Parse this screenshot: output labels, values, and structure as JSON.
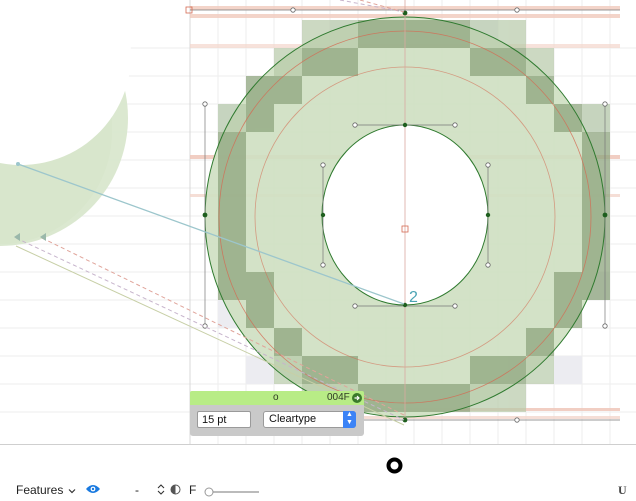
{
  "glyph_panel": {
    "glyph_name": "o",
    "unicode": "004F",
    "go_icon": "arrow-right-circle-icon",
    "size_value": "15 pt",
    "rendering_mode": "Cleartype"
  },
  "canvas": {
    "point_label": "2",
    "colors": {
      "glyph_fill": "#cfe0c2",
      "pixel_dark": "#8ea57e",
      "outline": "#2f7a2f",
      "hint_lines": "#e3b3a6"
    }
  },
  "preview": {
    "glyph": "o"
  },
  "toolbar": {
    "features_label": "Features",
    "features_chevron_icon": "chevron-down-icon",
    "eye_icon": "eye-icon",
    "dash_label": "-",
    "stepper_icon": "up-down-arrows-icon",
    "contrast_icon": "contrast-icon",
    "f_label": "F",
    "slider_icon": "zoom-slider",
    "right_icon_label": "U"
  }
}
